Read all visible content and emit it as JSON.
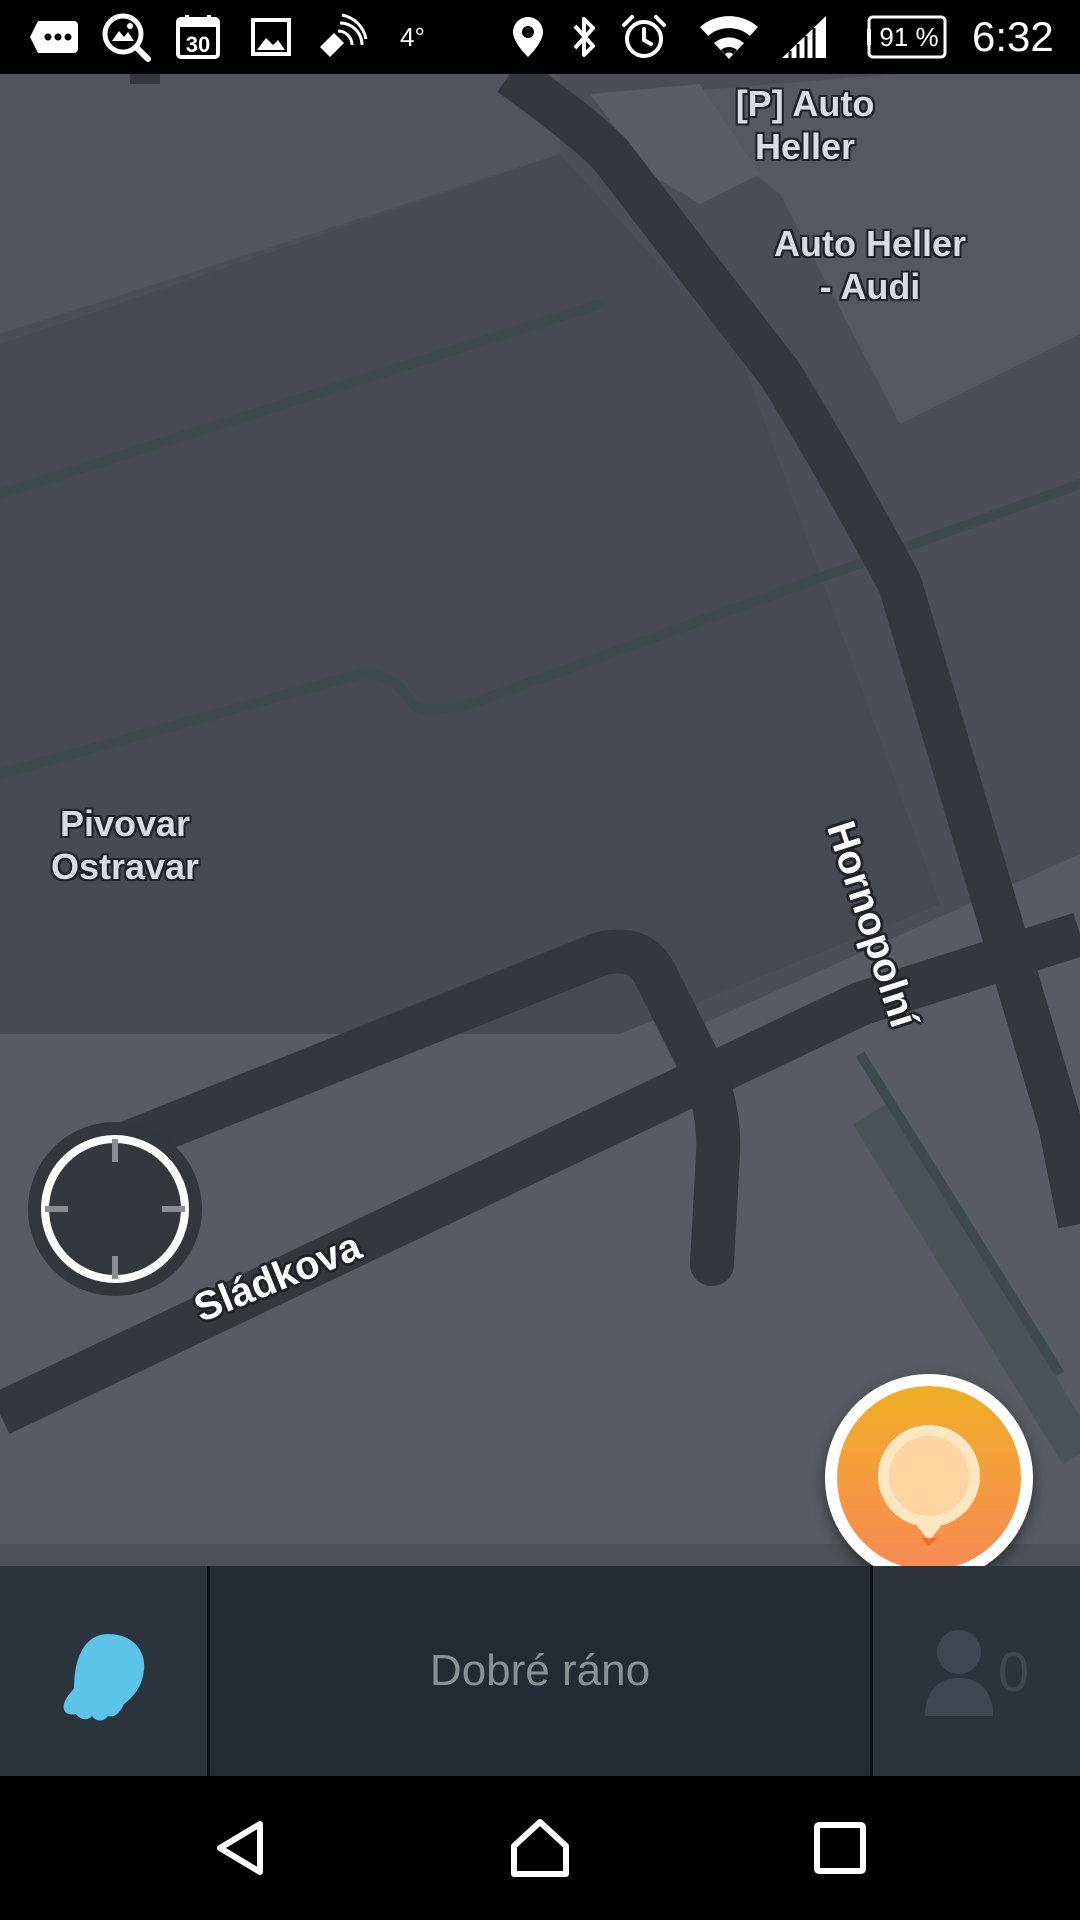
{
  "status_bar": {
    "temperature": "4°",
    "battery_percent": "91 %",
    "battery_level": 0.91,
    "time": "6:32",
    "calendar_day": "30",
    "icons": [
      "notification-more-icon",
      "image-search-icon",
      "calendar-icon",
      "gallery-icon",
      "satellite-icon",
      "location-pin-icon",
      "bluetooth-icon",
      "alarm-icon",
      "wifi-icon",
      "cell-signal-icon",
      "battery-icon"
    ]
  },
  "map": {
    "places": [
      {
        "name": "[P] Auto\nHeller"
      },
      {
        "name": "Auto Heller\n- Audi"
      },
      {
        "name": "Pivovar\nOstravar"
      }
    ],
    "streets": [
      {
        "name": "Hornopolní"
      },
      {
        "name": "Sládkova"
      }
    ],
    "colors": {
      "background": "#4b4f55",
      "block": "#55595f",
      "road": "#34373c",
      "rail": "#3f4a4b"
    }
  },
  "bottom_bar": {
    "greeting": "Dobré ráno",
    "friends_count": "0",
    "menu_icon": "waze-ghost-icon",
    "friends_icon": "person-icon",
    "accent_color": "#5cc4e8"
  },
  "nav_bar": {
    "buttons": [
      "back-icon",
      "home-icon",
      "recents-icon"
    ]
  }
}
